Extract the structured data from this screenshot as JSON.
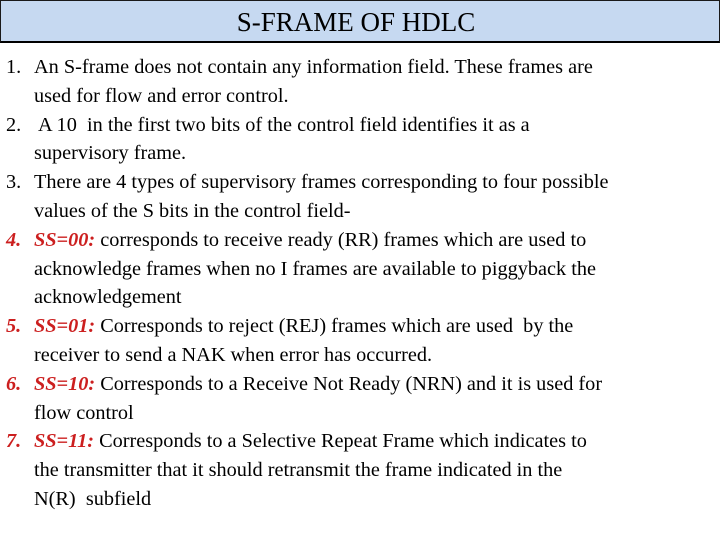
{
  "slide": {
    "title": "S-FRAME OF HDLC",
    "colors": {
      "title_background": "#c6d9f1",
      "highlight_red": "#cc1f1f",
      "text": "#000000"
    },
    "items": [
      {
        "number": "1.",
        "code": "",
        "lines": [
          "An S-frame does not contain any information field. These frames are",
          "used for flow and error control."
        ]
      },
      {
        "number": "2.",
        "code": "",
        "lines": [
          " A 10  in the first two bits of the control field identifies it as a",
          "supervisory frame."
        ]
      },
      {
        "number": "3.",
        "code": "",
        "lines": [
          "There are 4 types of supervisory frames corresponding to four possible",
          "values of the S bits in the control field-"
        ]
      },
      {
        "number": "4.",
        "code": "SS=00:",
        "lines": [
          " corresponds to receive ready (RR) frames which are used to",
          "acknowledge frames when no I frames are available to piggyback the",
          "acknowledgement"
        ]
      },
      {
        "number": "5.",
        "code": "SS=01:",
        "lines": [
          " Corresponds to reject (REJ) frames which are used  by the",
          "receiver to send a NAK when error has occurred."
        ]
      },
      {
        "number": "6.",
        "code": "SS=10:",
        "lines": [
          " Corresponds to a Receive Not Ready (NRN) and it is used for",
          "flow control"
        ]
      },
      {
        "number": "7.",
        "code": "SS=11:",
        "lines": [
          " Corresponds to a Selective Repeat Frame which indicates to",
          "the transmitter that it should retransmit the frame indicated in the",
          "N(R)  subfield"
        ]
      }
    ]
  }
}
